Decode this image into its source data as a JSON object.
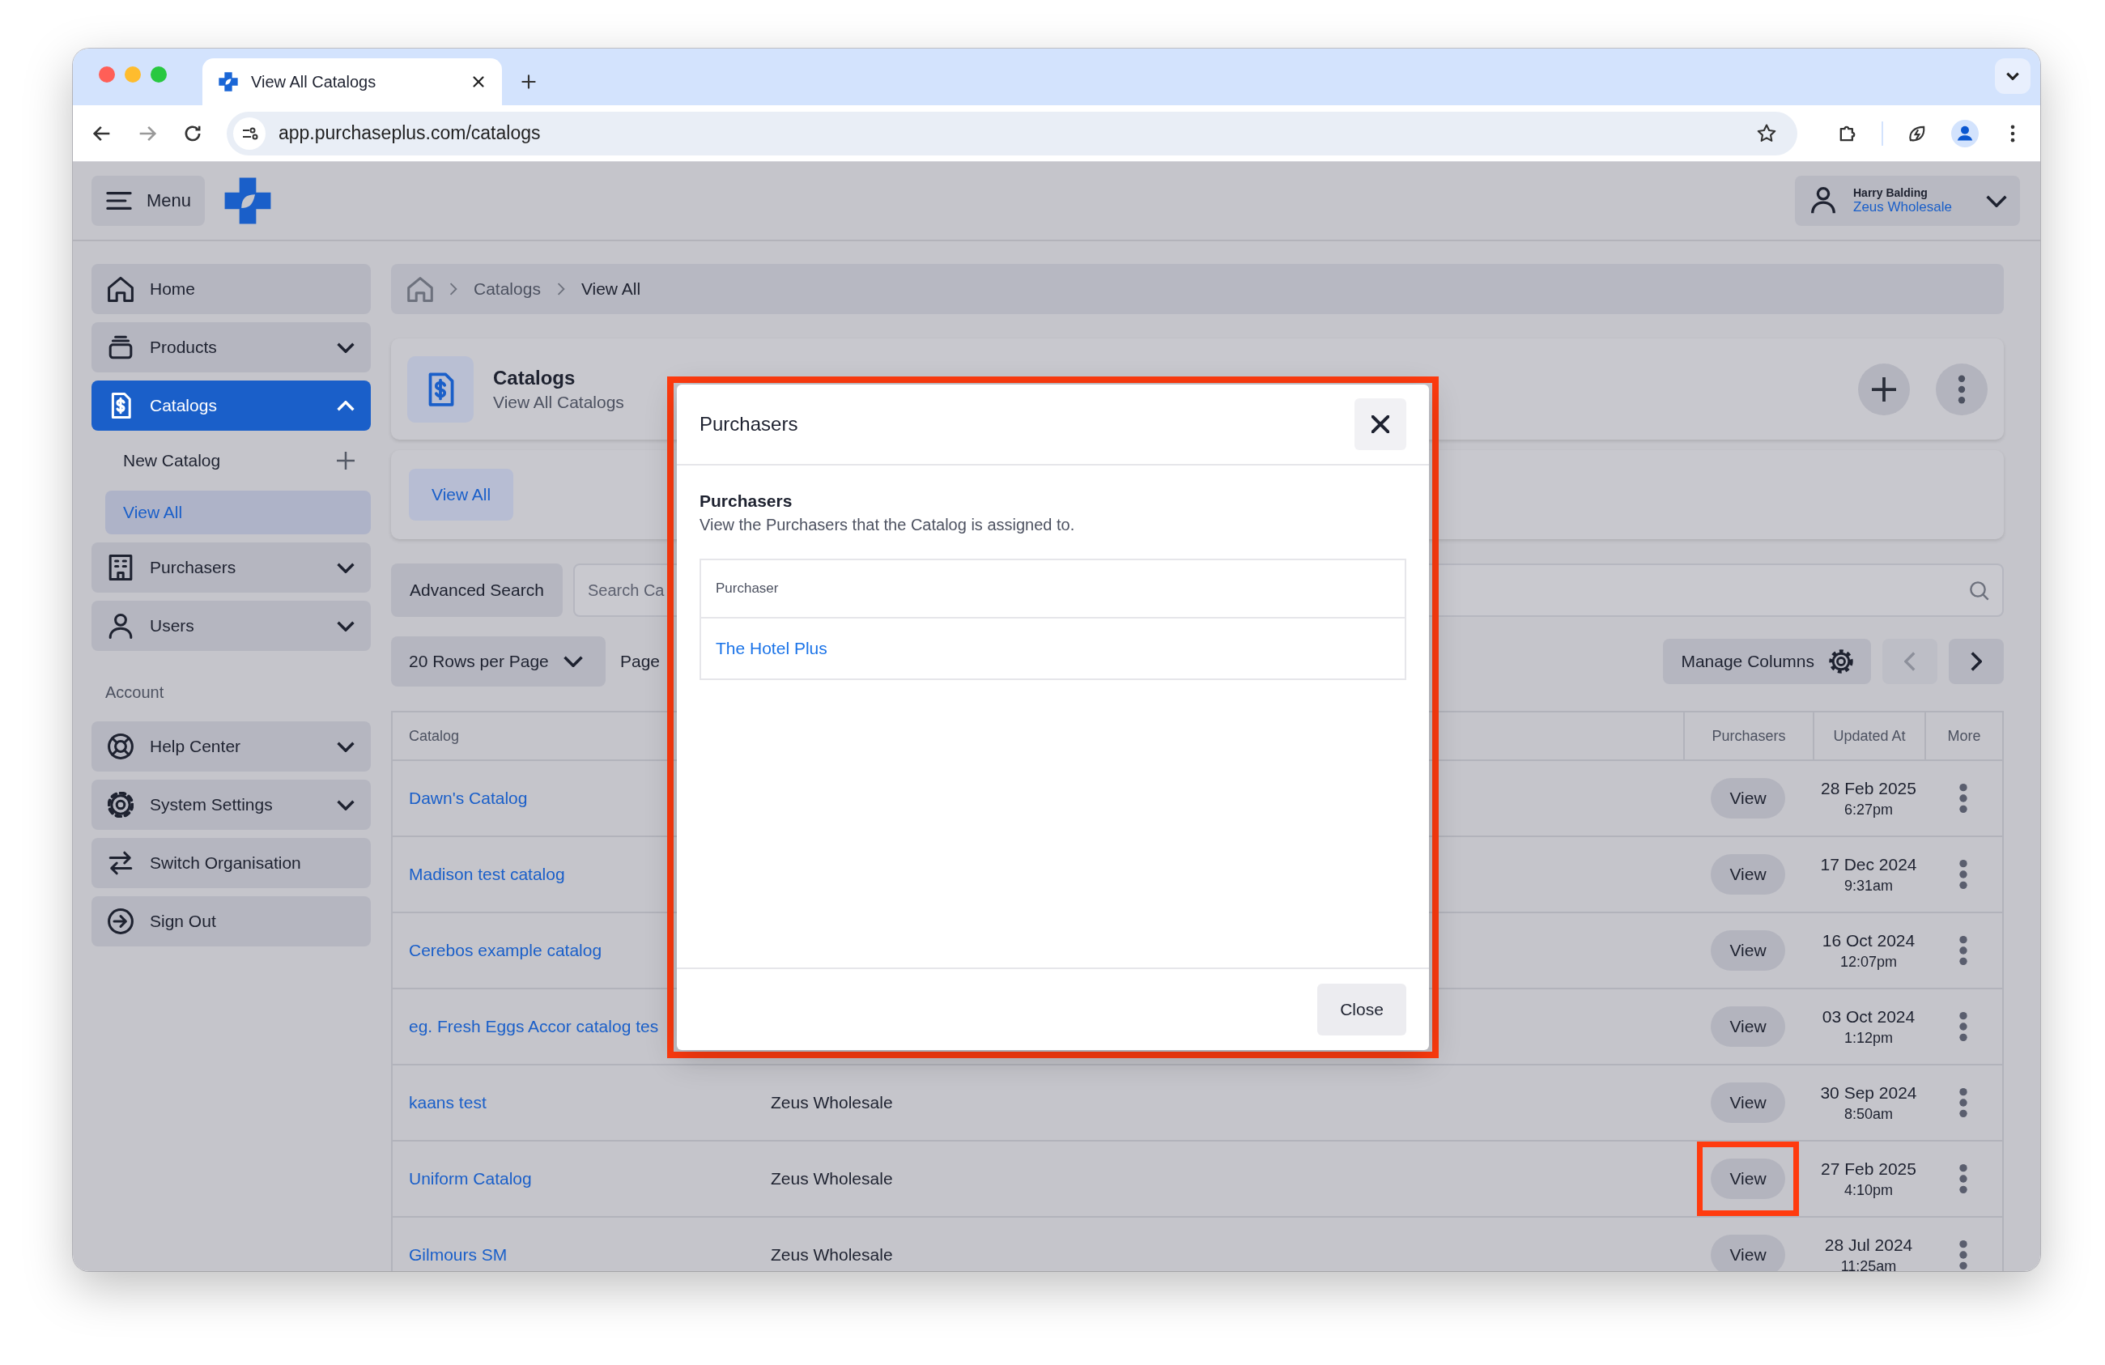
{
  "browser": {
    "tab_title": "View All Catalogs",
    "url": "app.purchaseplus.com/catalogs"
  },
  "header": {
    "menu_label": "Menu",
    "user": {
      "name": "Harry Balding",
      "organisation": "Zeus Wholesale"
    }
  },
  "sidebar": {
    "groups": [
      {
        "items": [
          {
            "label": "Home",
            "selected": false
          },
          {
            "label": "Products",
            "selected": false,
            "expanded": false
          },
          {
            "label": "Catalogs",
            "selected": true,
            "expanded": true,
            "children": [
              {
                "label": "New Catalog",
                "kind": "action",
                "selected": false
              },
              {
                "label": "View All",
                "kind": "link",
                "selected": true
              }
            ]
          },
          {
            "label": "Purchasers",
            "selected": false,
            "expanded": false
          },
          {
            "label": "Users",
            "selected": false,
            "expanded": false
          }
        ]
      },
      {
        "heading": "Account",
        "items": [
          {
            "label": "Help Center",
            "selected": false,
            "expanded": false
          },
          {
            "label": "System Settings",
            "selected": false,
            "expanded": false
          },
          {
            "label": "Switch Organisation",
            "selected": false
          },
          {
            "label": "Sign Out",
            "selected": false
          }
        ]
      }
    ]
  },
  "breadcrumbs": [
    "Catalogs",
    "View All"
  ],
  "page_header": {
    "title": "Catalogs",
    "subtitle": "View All Catalogs"
  },
  "tabs": [
    {
      "label": "View All",
      "selected": true
    }
  ],
  "search": {
    "button": "Advanced Search",
    "placeholder": "Search Ca"
  },
  "pagination": {
    "rows_per_page": "20 Rows per Page",
    "page_label": "Page",
    "manage_columns": "Manage Columns",
    "prev_disabled": true
  },
  "table": {
    "columns": [
      "Catalog",
      "Purchasers",
      "Updated At",
      "More"
    ],
    "rows": [
      {
        "catalog": "Dawn's Catalog",
        "purchasers": "View",
        "updated_date": "28 Feb 2025",
        "updated_time": "6:27pm",
        "highlighted": false
      },
      {
        "catalog": "Madison test catalog",
        "purchasers": "View",
        "updated_date": "17 Dec 2024",
        "updated_time": "9:31am",
        "highlighted": false
      },
      {
        "catalog": "Cerebos example catalog",
        "purchasers": "View",
        "updated_date": "16 Oct 2024",
        "updated_time": "12:07pm",
        "highlighted": false
      },
      {
        "catalog": "eg. Fresh Eggs Accor catalog tes",
        "purchasers": "View",
        "updated_date": "03 Oct 2024",
        "updated_time": "1:12pm",
        "highlighted": false
      },
      {
        "catalog": "kaans test",
        "column_2": "Zeus Wholesale",
        "purchasers": "View",
        "updated_date": "30 Sep 2024",
        "updated_time": "8:50am",
        "highlighted": false
      },
      {
        "catalog": "Uniform Catalog",
        "column_2": "Zeus Wholesale",
        "purchasers": "View",
        "updated_date": "27 Feb 2025",
        "updated_time": "4:10pm",
        "highlighted": true
      },
      {
        "catalog": "Gilmours SM",
        "column_2": "Zeus Wholesale",
        "purchasers": "View",
        "updated_date": "28 Jul 2024",
        "updated_time": "11:25am",
        "highlighted": false
      }
    ]
  },
  "modal": {
    "title": "Purchasers",
    "highlighted": true,
    "section_title": "Purchasers",
    "description": "View the Purchasers that the Catalog is assigned to.",
    "table": {
      "column": "Purchaser",
      "rows": [
        "The Hotel Plus"
      ]
    },
    "close_button": "Close"
  }
}
